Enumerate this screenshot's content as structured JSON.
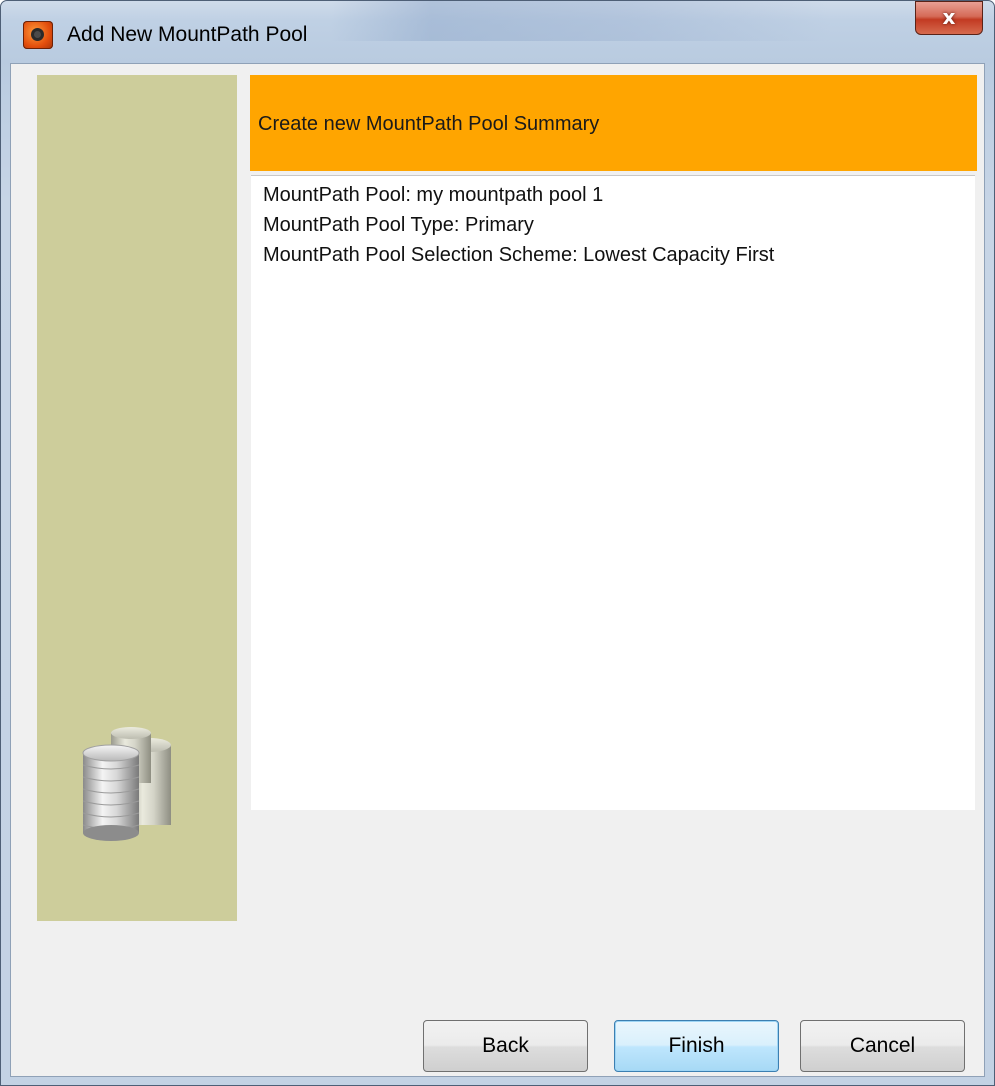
{
  "window": {
    "title": "Add New MountPath Pool",
    "close_label": "x"
  },
  "wizard": {
    "header": "Create new MountPath Pool Summary",
    "summary": [
      "MountPath Pool: my mountpath pool 1",
      "MountPath Pool Type: Primary",
      "MountPath Pool Selection Scheme: Lowest Capacity First"
    ]
  },
  "buttons": {
    "back": "Back",
    "finish": "Finish",
    "cancel": "Cancel"
  },
  "icons": {
    "app": "commvault-app-icon",
    "side": "disk-stack-icon",
    "close": "close-icon"
  },
  "colors": {
    "header_band": "#ffa500",
    "side_panel": "#cdcd9b",
    "close_button": "#c9462e"
  }
}
